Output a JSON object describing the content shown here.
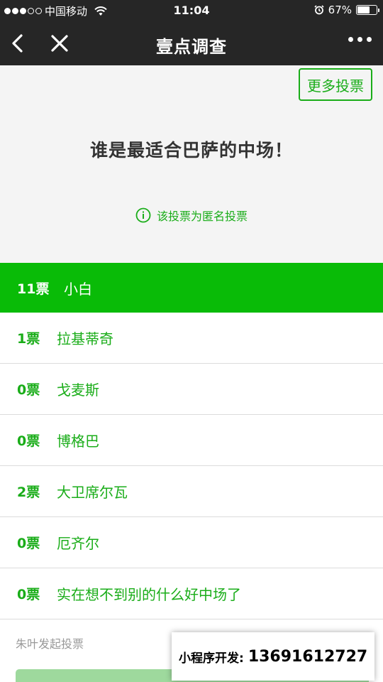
{
  "status_bar": {
    "carrier": "中国移动",
    "time": "11:04",
    "battery_percent": "67%",
    "battery_level": 0.67
  },
  "nav": {
    "title": "壹点调查"
  },
  "header": {
    "more_votes_label": "更多投票",
    "poll_title": "谁是最适合巴萨的中场！",
    "anonymous_notice": "该投票为匿名投票"
  },
  "options": [
    {
      "count": "11票",
      "name": "小白",
      "selected": true
    },
    {
      "count": "1票",
      "name": "拉基蒂奇",
      "selected": false
    },
    {
      "count": "0票",
      "name": "戈麦斯",
      "selected": false
    },
    {
      "count": "0票",
      "name": "博格巴",
      "selected": false
    },
    {
      "count": "2票",
      "name": "大卫席尔瓦",
      "selected": false
    },
    {
      "count": "0票",
      "name": "厄齐尔",
      "selected": false
    },
    {
      "count": "0票",
      "name": "实在想不到别的什么好中场了",
      "selected": false
    }
  ],
  "footer": {
    "initiator": "朱叶发起投票"
  },
  "ad": {
    "label": "小程序开发:",
    "phone": "13691612727"
  },
  "colors": {
    "accent": "#1aad19",
    "selected_bg": "#09bb07",
    "nav_bg": "#262626"
  }
}
